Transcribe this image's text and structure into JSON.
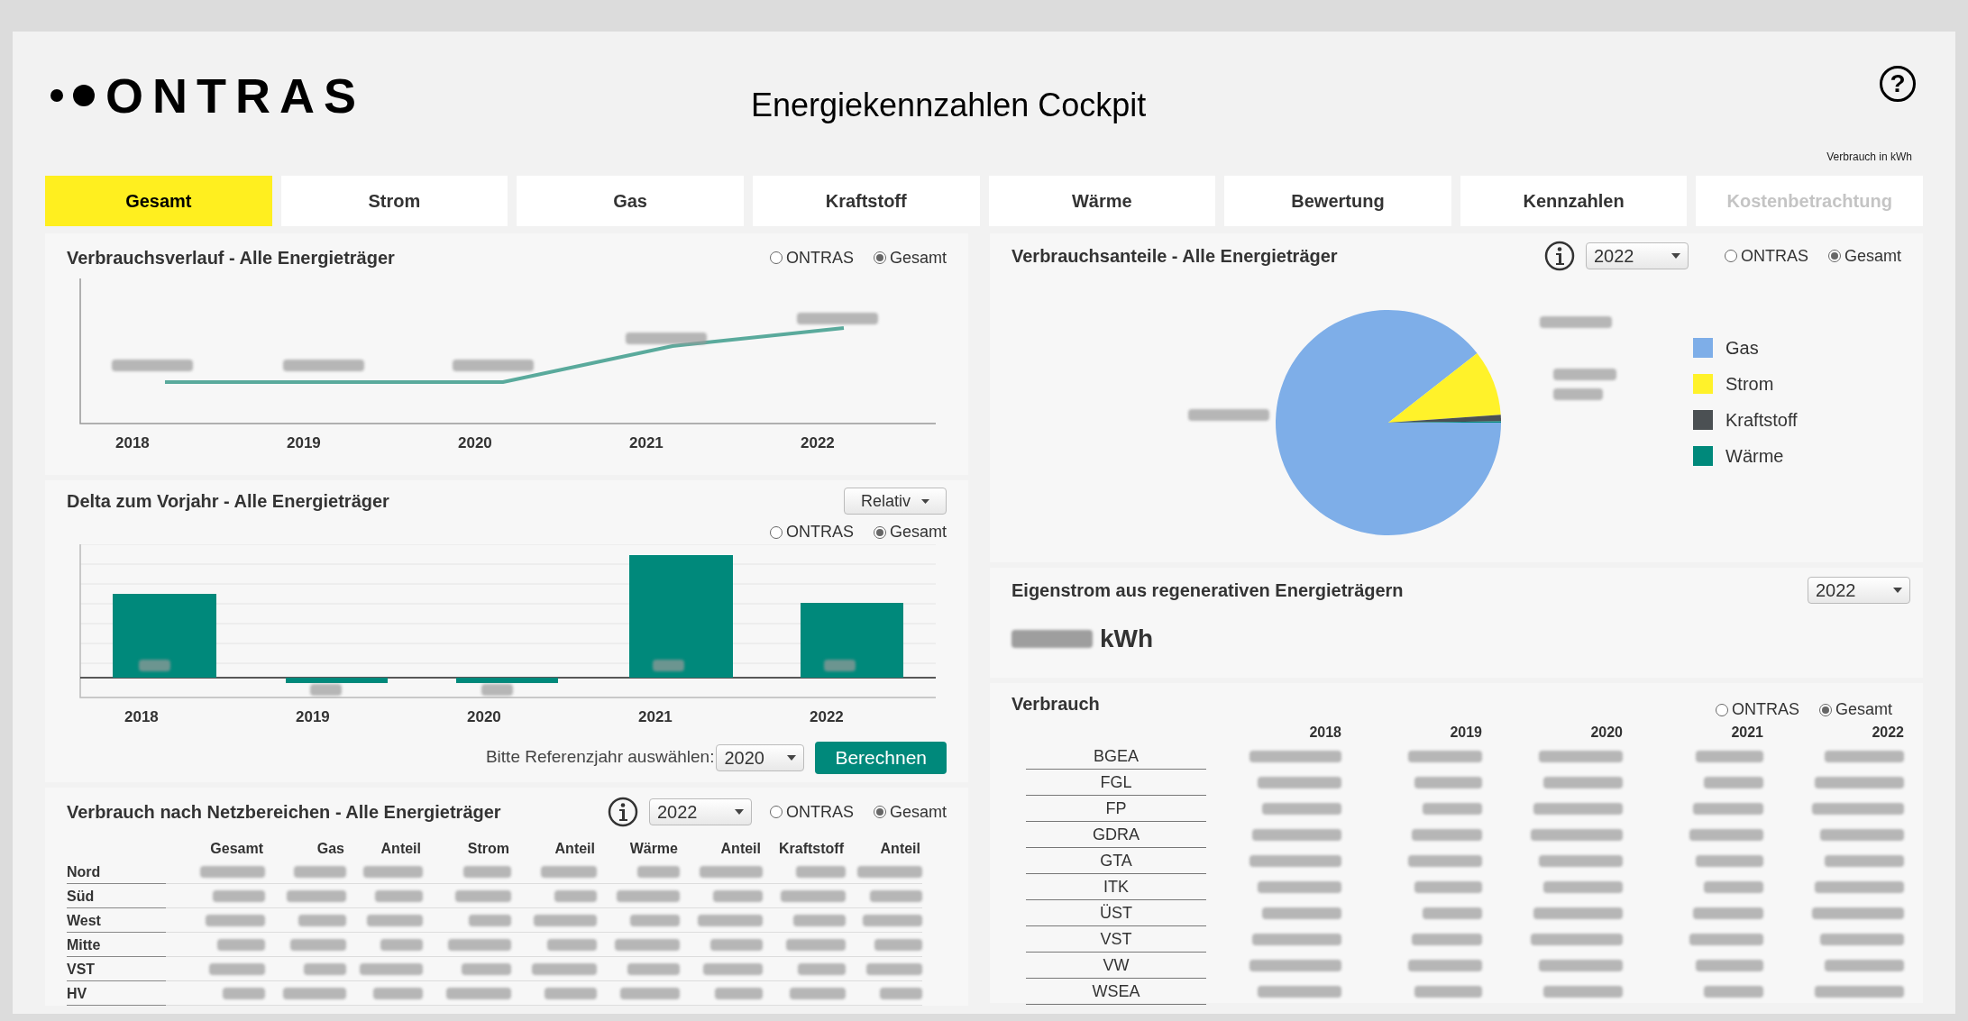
{
  "header": {
    "logo": "ONTRAS",
    "title": "Energiekennzahlen Cockpit",
    "help": "?",
    "unit_note": "Verbrauch in kWh"
  },
  "tabs": [
    {
      "label": "Gesamt",
      "selected": true,
      "disabled": false
    },
    {
      "label": "Strom",
      "selected": false,
      "disabled": false
    },
    {
      "label": "Gas",
      "selected": false,
      "disabled": false
    },
    {
      "label": "Kraftstoff",
      "selected": false,
      "disabled": false
    },
    {
      "label": "Wärme",
      "selected": false,
      "disabled": false
    },
    {
      "label": "Bewertung",
      "selected": false,
      "disabled": false
    },
    {
      "label": "Kennzahlen",
      "selected": false,
      "disabled": false
    },
    {
      "label": "Kostenbetrachtung",
      "selected": false,
      "disabled": true
    }
  ],
  "consumption_trend": {
    "title": "Verbrauchsverlauf - Alle Energieträger",
    "scope": [
      {
        "label": "ONTRAS",
        "selected": false
      },
      {
        "label": "Gesamt",
        "selected": true
      }
    ],
    "years": [
      "2018",
      "2019",
      "2020",
      "2021",
      "2022"
    ]
  },
  "delta": {
    "title": "Delta zum Vorjahr - Alle Energieträger",
    "mode": "Relativ",
    "scope": [
      {
        "label": "ONTRAS",
        "selected": false
      },
      {
        "label": "Gesamt",
        "selected": true
      }
    ],
    "years": [
      "2018",
      "2019",
      "2020",
      "2021",
      "2022"
    ],
    "reference_label": "Bitte Referenzjahr auswählen:",
    "reference_year": "2020",
    "button": "Berechnen"
  },
  "network_areas": {
    "title": "Verbrauch nach Netzbereichen - Alle Energieträger",
    "year": "2022",
    "scope": [
      {
        "label": "ONTRAS",
        "selected": false
      },
      {
        "label": "Gesamt",
        "selected": true
      }
    ],
    "columns": [
      "Gesamt",
      "Gas",
      "Anteil",
      "Strom",
      "Anteil",
      "Wärme",
      "Anteil",
      "Kraftstoff",
      "Anteil"
    ],
    "rows": [
      "Nord",
      "Süd",
      "West",
      "Mitte",
      "VST",
      "HV"
    ]
  },
  "shares": {
    "title": "Verbrauchsanteile - Alle Energieträger",
    "year": "2022",
    "scope": [
      {
        "label": "ONTRAS",
        "selected": false
      },
      {
        "label": "Gesamt",
        "selected": true
      }
    ],
    "legend": [
      {
        "label": "Gas",
        "color": "#7eaee8"
      },
      {
        "label": "Strom",
        "color": "#fff22a"
      },
      {
        "label": "Kraftstoff",
        "color": "#4b5053"
      },
      {
        "label": "Wärme",
        "color": "#00897b"
      }
    ]
  },
  "own_power": {
    "title": "Eigenstrom aus regenerativen Energieträgern",
    "year": "2022",
    "unit": "kWh"
  },
  "consumption": {
    "title": "Verbrauch",
    "scope": [
      {
        "label": "ONTRAS",
        "selected": false
      },
      {
        "label": "Gesamt",
        "selected": true
      }
    ],
    "columns": [
      "2018",
      "2019",
      "2020",
      "2021",
      "2022"
    ],
    "rows": [
      "BGEA",
      "FGL",
      "FP",
      "GDRA",
      "GTA",
      "ITK",
      "ÜST",
      "VST",
      "VW",
      "WSEA"
    ]
  }
}
